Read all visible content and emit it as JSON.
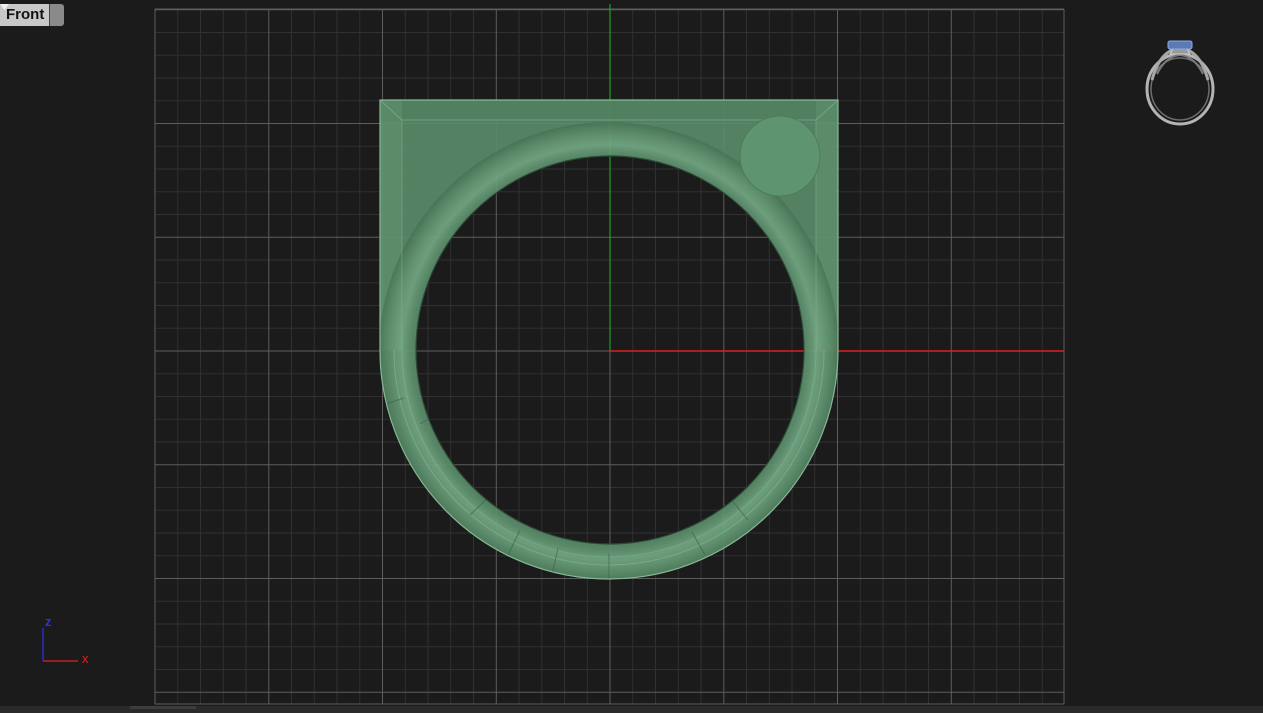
{
  "viewport": {
    "name": "Front",
    "dropdown_icon": "chevron-down-icon"
  },
  "axes_widget": {
    "z_label": "z",
    "x_label": "x"
  },
  "colors": {
    "background": "#1b1b1b",
    "grid_minor": "#303030",
    "grid_major": "#5d5d5d",
    "x_axis": "#e02020",
    "y_axis": "#1ea01e",
    "ring_fill": "#5a8d6a",
    "ring_edge": "#87b896",
    "gnomon_z": "#3030e0",
    "gnomon_x": "#e02020"
  },
  "model": {
    "object": "ring",
    "preview_icon": "ring-preview-icon"
  }
}
